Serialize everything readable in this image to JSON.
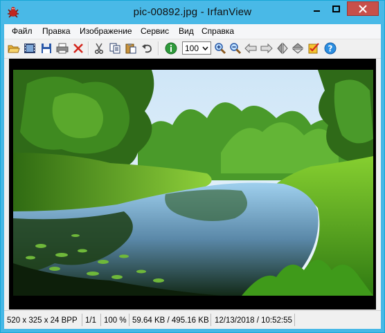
{
  "window": {
    "title": "pic-00892.jpg - IrfanView"
  },
  "menu": {
    "items": [
      "Файл",
      "Правка",
      "Изображение",
      "Сервис",
      "Вид",
      "Справка"
    ]
  },
  "toolbar": {
    "zoom_value": "100",
    "icons": [
      "open-folder-icon",
      "filmstrip-icon",
      "save-icon",
      "print-icon",
      "delete-icon",
      "cut-icon",
      "copy-icon",
      "paste-icon",
      "undo-icon",
      "info-icon",
      "zoom-in-icon",
      "zoom-out-icon",
      "previous-icon",
      "next-icon",
      "flip-horizontal-icon",
      "flip-vertical-icon",
      "checklist-icon",
      "help-icon"
    ]
  },
  "statusbar": {
    "dimensions": "520 x 325 x 24 BPP",
    "page": "1/1",
    "zoom": "100 %",
    "filesize": "59.64 KB / 495.16 KB",
    "datetime": "12/13/2018 / 10:52:55"
  },
  "colors": {
    "titlebar": "#49b9e7",
    "close_button": "#c7504a",
    "viewer_background": "#000000"
  }
}
